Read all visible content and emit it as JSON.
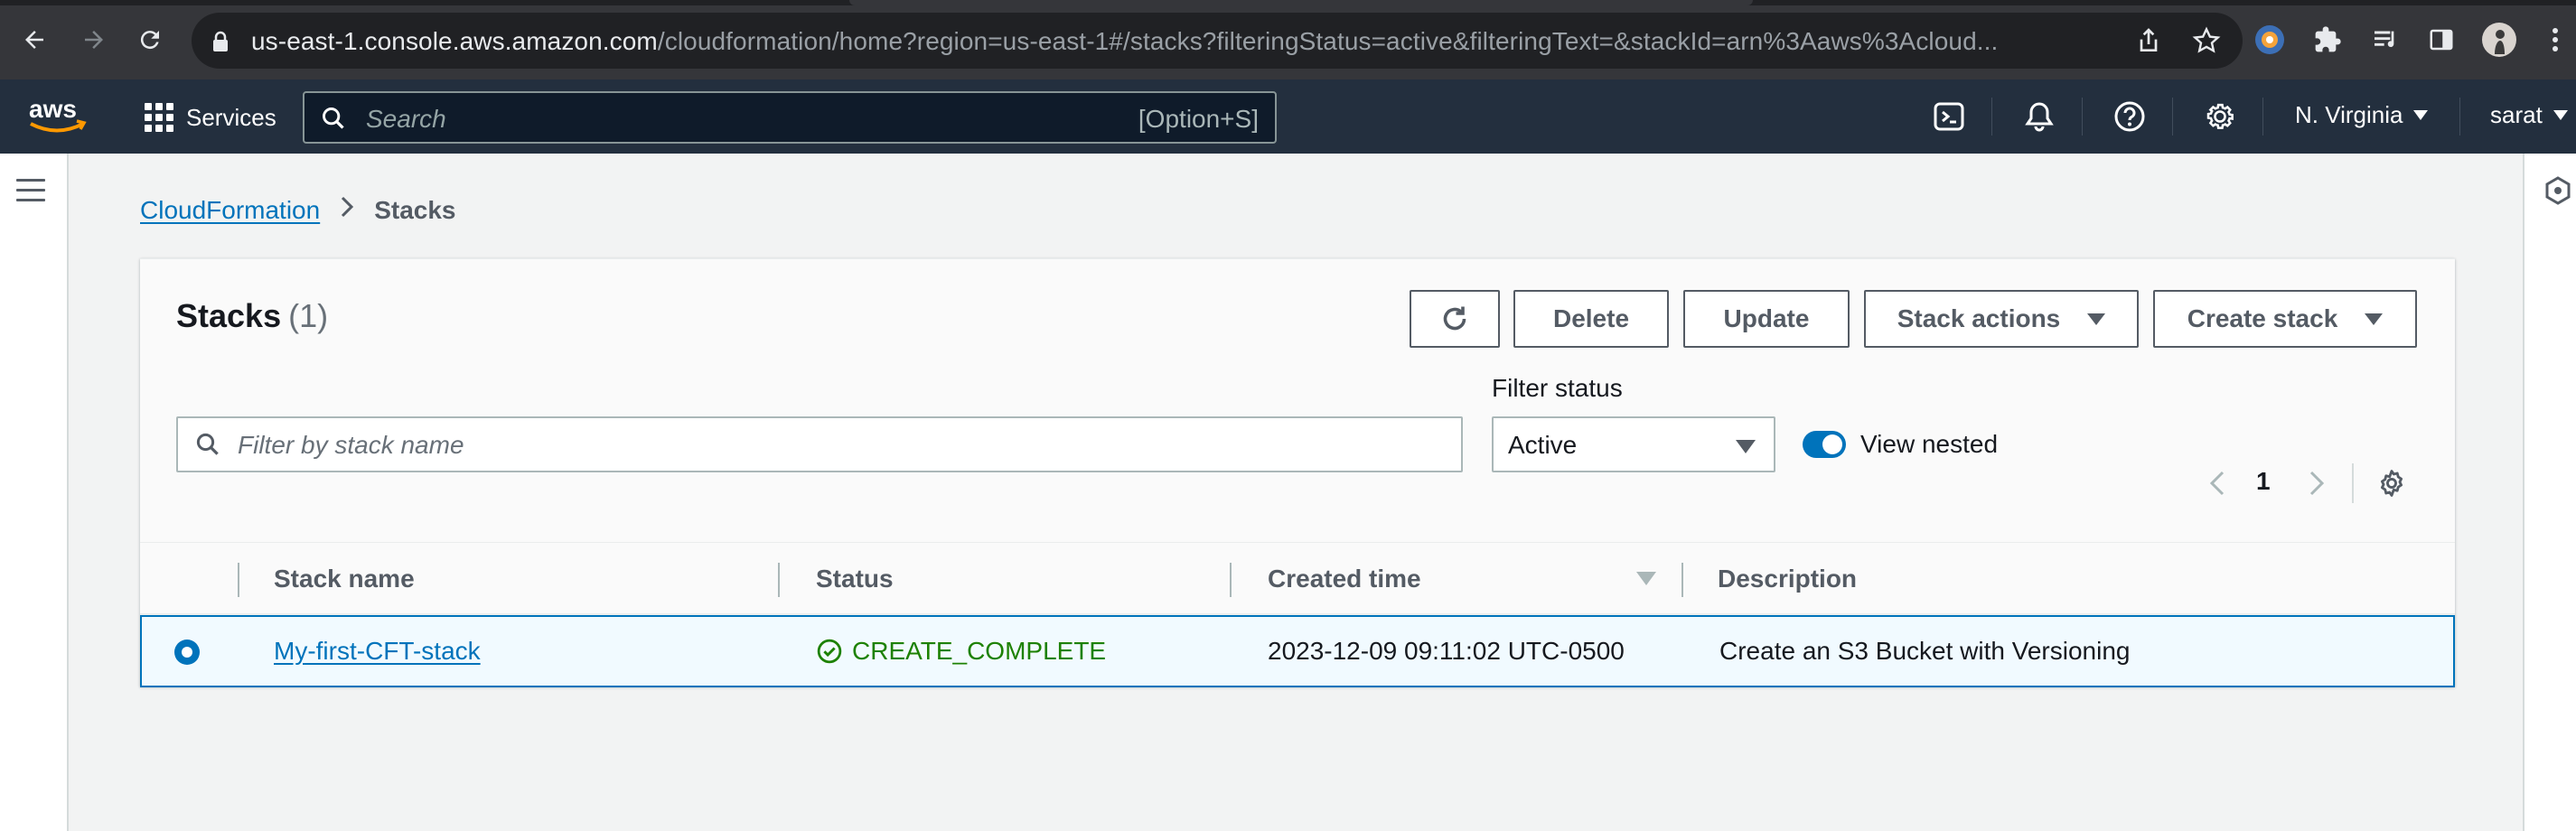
{
  "browser": {
    "url_host": "us-east-1.console.aws.amazon.com",
    "url_path": "/cloudformation/home?region=us-east-1#/stacks?filteringStatus=active&filteringText=&stackId=arn%3Aaws%3Acloud..."
  },
  "awsnav": {
    "services_label": "Services",
    "search_placeholder": "Search",
    "search_shortcut": "[Option+S]",
    "region": "N. Virginia",
    "user": "sarat"
  },
  "breadcrumb": {
    "parent": "CloudFormation",
    "current": "Stacks"
  },
  "panel": {
    "title": "Stacks",
    "count": "(1)",
    "buttons": {
      "delete": "Delete",
      "update": "Update",
      "stack_actions": "Stack actions",
      "create_stack": "Create stack"
    },
    "filter_placeholder": "Filter by stack name",
    "filter_status_label": "Filter status",
    "filter_status_value": "Active",
    "view_nested_label": "View nested",
    "view_nested_on": true,
    "page": "1"
  },
  "table": {
    "columns": [
      "Stack name",
      "Status",
      "Created time",
      "Description"
    ],
    "rows": [
      {
        "stack_name": "My-first-CFT-stack",
        "status": "CREATE_COMPLETE",
        "created_time": "2023-12-09 09:11:02 UTC-0500",
        "description": "Create an S3 Bucket with Versioning",
        "selected": true
      }
    ]
  },
  "colors": {
    "link": "#0073bb",
    "success": "#1d8102",
    "nav_bg": "#232f3e",
    "aws_orange": "#ff9900"
  }
}
